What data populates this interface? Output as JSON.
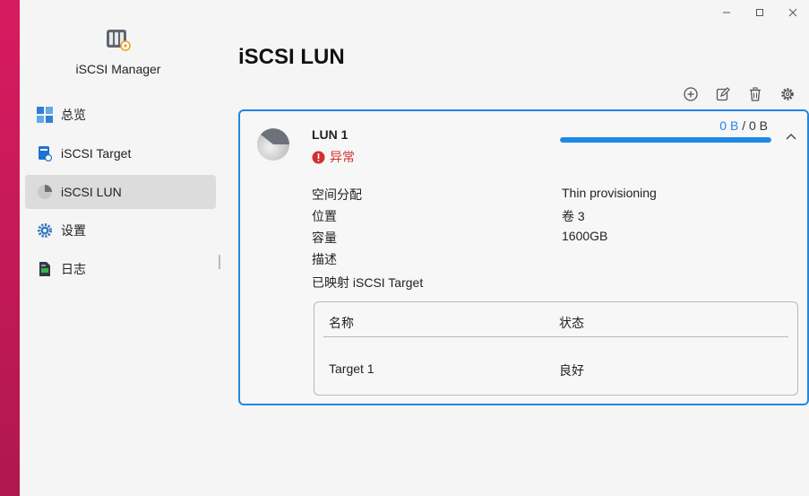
{
  "app": {
    "title": "iSCSI Manager"
  },
  "window_controls": {
    "minimize": "minimize",
    "maximize": "maximize",
    "close": "close"
  },
  "sidebar": {
    "items": [
      {
        "label": "总览",
        "icon": "overview-grid-icon",
        "active": false
      },
      {
        "label": "iSCSI Target",
        "icon": "target-icon",
        "active": false
      },
      {
        "label": "iSCSI LUN",
        "icon": "lun-pie-icon",
        "active": true
      },
      {
        "label": "设置",
        "icon": "gear-icon",
        "active": false
      },
      {
        "label": "日志",
        "icon": "log-file-icon",
        "active": false
      }
    ]
  },
  "main": {
    "title": "iSCSI LUN",
    "toolbar": [
      "add-icon",
      "edit-icon",
      "delete-icon",
      "settings-icon"
    ]
  },
  "lun": {
    "name": "LUN 1",
    "status": "异常",
    "usage_used": "0 B",
    "usage_sep": " / ",
    "usage_total": "0 B",
    "usage_fraction": 1.0,
    "properties": [
      {
        "label": "空间分配",
        "value": "Thin provisioning"
      },
      {
        "label": "位置",
        "value": "卷 3"
      },
      {
        "label": "容量",
        "value": "1600GB"
      },
      {
        "label": "描述",
        "value": ""
      },
      {
        "label": "已映射 iSCSI Target",
        "value": ""
      }
    ],
    "targets": {
      "headers": {
        "name": "名称",
        "status": "状态"
      },
      "rows": [
        {
          "name": "Target 1",
          "status": "良好"
        }
      ]
    }
  },
  "colors": {
    "accent": "#1e88e5",
    "error": "#d32f2f",
    "active_nav": "#dcdcdc"
  }
}
